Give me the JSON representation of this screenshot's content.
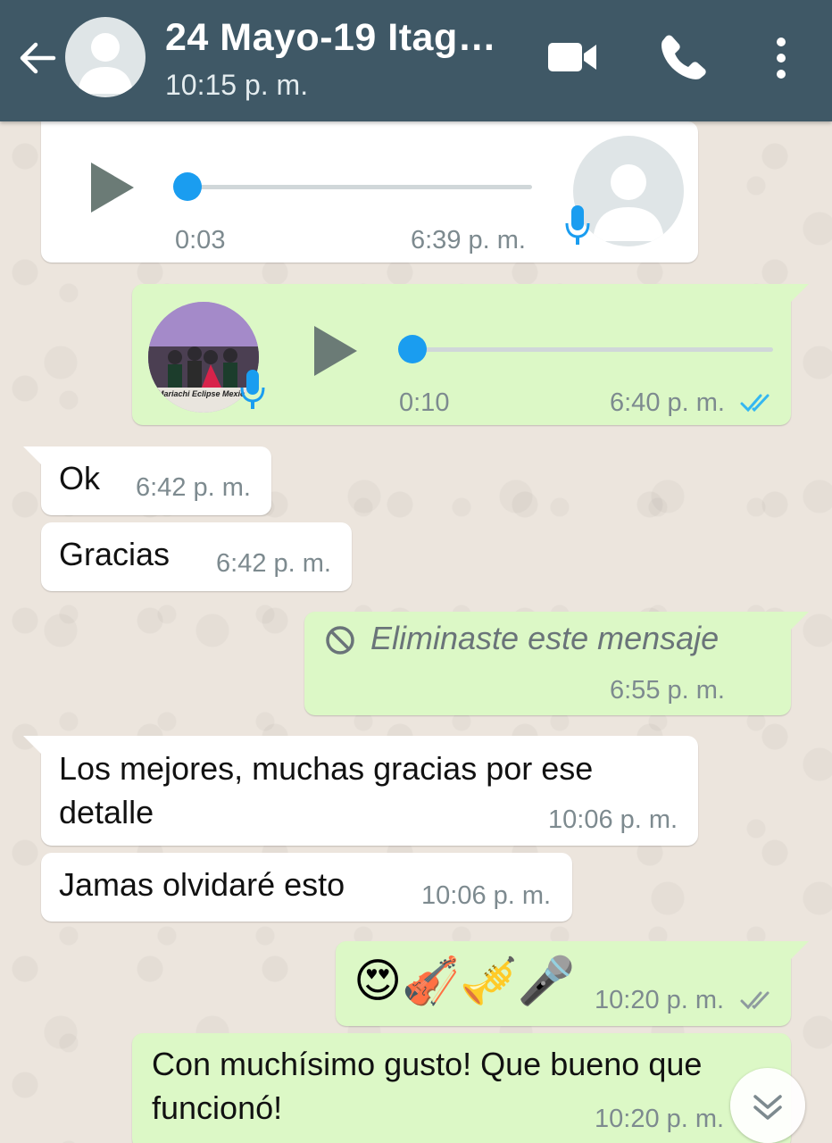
{
  "header": {
    "title": "24 Mayo-19 Itag…",
    "subtitle": "10:15 p. m.",
    "bg_color": "#3f5866"
  },
  "messages": [
    {
      "id": "m1",
      "type": "voice",
      "direction": "incoming",
      "duration": "0:03",
      "time": "6:39 p. m."
    },
    {
      "id": "m2",
      "type": "voice",
      "direction": "outgoing",
      "duration": "0:10",
      "time": "6:40 p. m.",
      "status": "read",
      "thumbnail_caption": "Mariachi Eclipse Mexic"
    },
    {
      "id": "m3",
      "type": "text",
      "direction": "incoming",
      "text": "Ok",
      "time": "6:42 p. m."
    },
    {
      "id": "m4",
      "type": "text",
      "direction": "incoming",
      "text": "Gracias",
      "time": "6:42 p. m."
    },
    {
      "id": "m5",
      "type": "deleted",
      "direction": "outgoing",
      "text": "Eliminaste este mensaje",
      "time": "6:55 p. m."
    },
    {
      "id": "m6",
      "type": "text",
      "direction": "incoming",
      "text": "Los mejores, muchas gracias por ese detalle",
      "time": "10:06 p. m."
    },
    {
      "id": "m7",
      "type": "text",
      "direction": "incoming",
      "text": "Jamas olvidaré esto",
      "time": "10:06 p. m."
    },
    {
      "id": "m8",
      "type": "emoji",
      "direction": "outgoing",
      "text": "😍🎻🎺🎤",
      "time": "10:20 p. m.",
      "status": "delivered"
    },
    {
      "id": "m9",
      "type": "text",
      "direction": "outgoing",
      "text": "Con muchísimo gusto! Que bueno que funcionó!",
      "time": "10:20 p. m."
    }
  ],
  "colors": {
    "incoming_bubble": "#ffffff",
    "outgoing_bubble": "#dcf8c6",
    "read_ticks": "#34b7f1",
    "voice_accent": "#1a9df0"
  }
}
